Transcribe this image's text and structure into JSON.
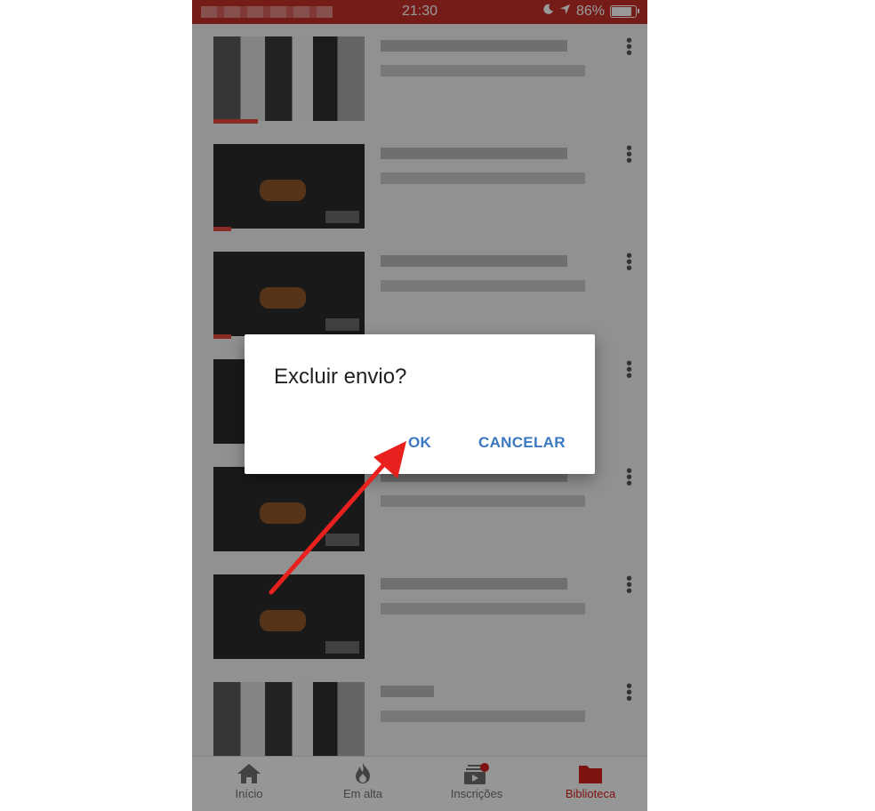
{
  "status_bar": {
    "time": "21:30",
    "battery": "86%",
    "icons": [
      "moon-icon",
      "location-arrow-icon",
      "battery-icon"
    ],
    "background_color": "#c4302b"
  },
  "dialog": {
    "title": "Excluir envio?",
    "ok_label": "OK",
    "cancel_label": "CANCELAR",
    "button_color": "#3b78c2"
  },
  "tabs": [
    {
      "label": "Início",
      "icon": "home-icon",
      "active": false
    },
    {
      "label": "Em alta",
      "icon": "flame-icon",
      "active": false
    },
    {
      "label": "Inscrições",
      "icon": "subscriptions-icon",
      "active": false
    },
    {
      "label": "Biblioteca",
      "icon": "folder-icon",
      "active": true
    }
  ],
  "accent_color": "#d0211b",
  "annotation": {
    "type": "arrow",
    "color": "#e8201e",
    "points_to": "ok-button"
  }
}
